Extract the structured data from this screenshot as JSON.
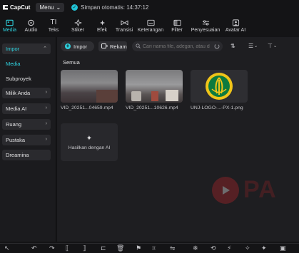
{
  "app": {
    "name": "CapCut",
    "menu_label": "Menu",
    "autosave_text": "Simpan otomatis: 14:37:12"
  },
  "tabs": [
    {
      "label": "Media",
      "icon": "media-icon",
      "active": true
    },
    {
      "label": "Audio",
      "icon": "audio-icon"
    },
    {
      "label": "Teks",
      "icon": "text-icon"
    },
    {
      "label": "Stiker",
      "icon": "sticker-icon"
    },
    {
      "label": "Efek",
      "icon": "effect-icon"
    },
    {
      "label": "Transisi",
      "icon": "transition-icon"
    },
    {
      "label": "Keterangan",
      "icon": "caption-icon"
    },
    {
      "label": "Filter",
      "icon": "filter-icon"
    },
    {
      "label": "Penyesuaian",
      "icon": "adjust-icon"
    },
    {
      "label": "Avatar AI",
      "icon": "avatar-ai-icon"
    }
  ],
  "sidebar": {
    "impor_label": "Impor",
    "media_label": "Media",
    "subproyek_label": "Subproyek",
    "items": [
      {
        "label": "Milik Anda"
      },
      {
        "label": "Media AI"
      },
      {
        "label": "Ruang"
      },
      {
        "label": "Pustaka"
      },
      {
        "label": "Dreamina"
      }
    ]
  },
  "toolbar": {
    "impor_label": "Impor",
    "rekam_label": "Rekam",
    "search_placeholder": "Cari nama file, adegan, atau d..."
  },
  "section_label": "Semua",
  "media": [
    {
      "filename": "VID_20251...04659.mp4"
    },
    {
      "filename": "VID_20251...10626.mp4"
    },
    {
      "filename": "UNJ-LOGO-...-PX-1.png"
    }
  ],
  "ai_card_label": "Hasilkan dengan AI",
  "watermark_text": "PA",
  "colors": {
    "accent": "#2fd3e0",
    "background": "#141416",
    "panel": "#1e1e21"
  }
}
